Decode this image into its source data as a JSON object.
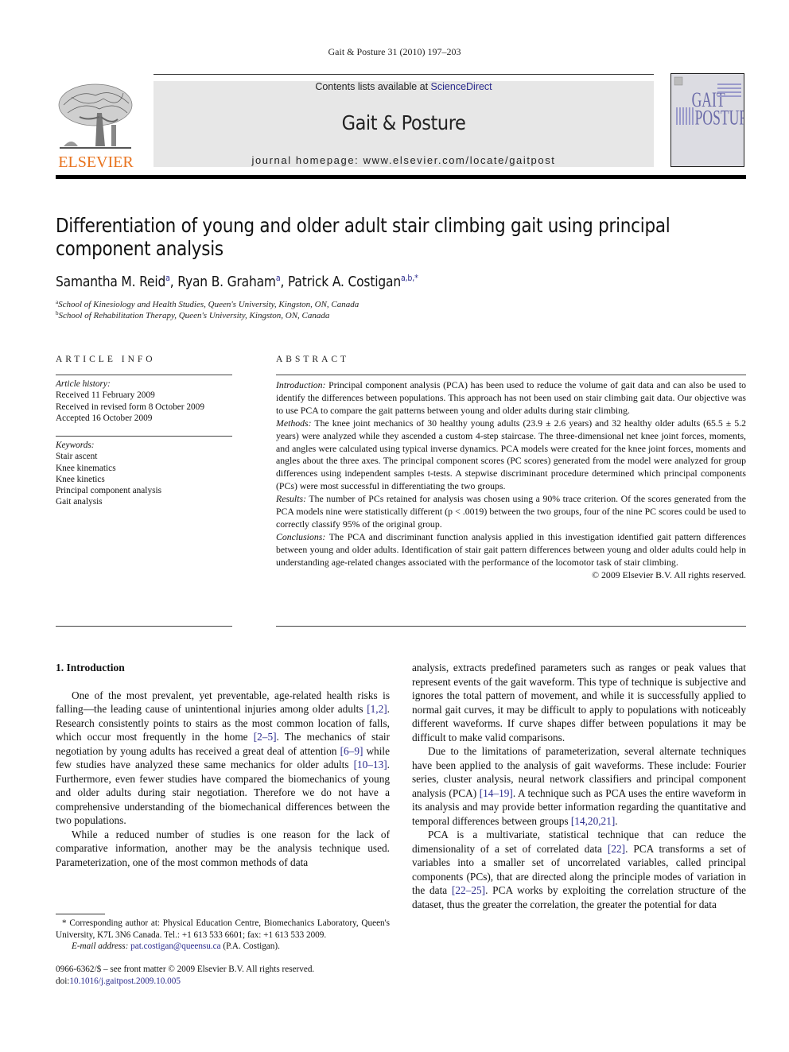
{
  "header": {
    "running_head": "Gait & Posture 31 (2010) 197–203",
    "contents_prefix": "Contents lists available at ",
    "contents_link": "ScienceDirect",
    "journal_name": "Gait & Posture",
    "homepage": "journal homepage: www.elsevier.com/locate/gaitpost",
    "publisher_logo": "ELSEVIER",
    "cover_title_top": "GAIT",
    "cover_title_bottom": "POSTURE",
    "colors": {
      "elsevier_orange": "#e8731e",
      "link_blue": "#2a2a8c",
      "banner_gray": "#e7e7e7"
    }
  },
  "article": {
    "title_line1": "Differentiation of young and older adult stair climbing gait using principal",
    "title_line2": "component analysis",
    "authors": [
      {
        "name": "Samantha M. Reid",
        "sup": "a",
        "sep": ", "
      },
      {
        "name": "Ryan B. Graham",
        "sup": "a",
        "sep": ", "
      },
      {
        "name": "Patrick A. Costigan",
        "sup": "a,b,*",
        "sep": ""
      }
    ],
    "affiliations": [
      {
        "mark": "a",
        "text": "School of Kinesiology and Health Studies, Queen's University, Kingston, ON, Canada"
      },
      {
        "mark": "b",
        "text": "School of Rehabilitation Therapy, Queen's University, Kingston, ON, Canada"
      }
    ]
  },
  "article_info": {
    "heading": "ARTICLE INFO",
    "history_label": "Article history:",
    "history": [
      "Received 11 February 2009",
      "Received in revised form 8 October 2009",
      "Accepted 16 October 2009"
    ],
    "keywords_label": "Keywords:",
    "keywords": [
      "Stair ascent",
      "Knee kinematics",
      "Knee kinetics",
      "Principal component analysis",
      "Gait analysis"
    ]
  },
  "abstract": {
    "heading": "ABSTRACT",
    "sections": [
      {
        "label": "Introduction:",
        "text": " Principal component analysis (PCA) has been used to reduce the volume of gait data and can also be used to identify the differences between populations. This approach has not been used on stair climbing gait data. Our objective was to use PCA to compare the gait patterns between young and older adults during stair climbing."
      },
      {
        "label": "Methods:",
        "text": " The knee joint mechanics of 30 healthy young adults (23.9 ± 2.6 years) and 32 healthy older adults (65.5 ± 5.2 years) were analyzed while they ascended a custom 4-step staircase. The three-dimensional net knee joint forces, moments, and angles were calculated using typical inverse dynamics. PCA models were created for the knee joint forces, moments and angles about the three axes. The principal component scores (PC scores) generated from the model were analyzed for group differences using independent samples t-tests. A stepwise discriminant procedure determined which principal components (PCs) were most successful in differentiating the two groups."
      },
      {
        "label": "Results:",
        "text": " The number of PCs retained for analysis was chosen using a 90% trace criterion. Of the scores generated from the PCA models nine were statistically different (p < .0019) between the two groups, four of the nine PC scores could be used to correctly classify 95% of the original group."
      },
      {
        "label": "Conclusions:",
        "text": " The PCA and discriminant function analysis applied in this investigation identified gait pattern differences between young and older adults. Identification of stair gait pattern differences between young and older adults could help in understanding age-related changes associated with the performance of the locomotor task of stair climbing."
      }
    ],
    "copyright": "© 2009 Elsevier B.V. All rights reserved."
  },
  "body": {
    "section_heading": "1. Introduction",
    "left_paragraphs": [
      [
        {
          "t": "One of the most prevalent, yet preventable, age-related health risks is falling—the leading cause of unintentional injuries among older adults "
        },
        {
          "ref": "[1,2]"
        },
        {
          "t": ". Research consistently points to stairs as the most common location of falls, which occur most frequently in the home "
        },
        {
          "ref": "[2–5]"
        },
        {
          "t": ". The mechanics of stair negotiation by young adults has received a great deal of attention "
        },
        {
          "ref": "[6–9]"
        },
        {
          "t": " while few studies have analyzed these same mechanics for older adults "
        },
        {
          "ref": "[10–13]"
        },
        {
          "t": ". Furthermore, even fewer studies have compared the biomechanics of young and older adults during stair negotiation. Therefore we do not have a comprehensive understanding of the biomechanical differences between the two populations."
        }
      ],
      [
        {
          "t": "While a reduced number of studies is one reason for the lack of comparative information, another may be the analysis technique used. Parameterization, one of the most common methods of data"
        }
      ]
    ],
    "right_paragraphs": [
      [
        {
          "t": "analysis, extracts predefined parameters such as ranges or peak values that represent events of the gait waveform. This type of technique is subjective and ignores the total pattern of movement, and while it is successfully applied to normal gait curves, it may be difficult to apply to populations with noticeably different waveforms. If curve shapes differ between populations it may be difficult to make valid comparisons."
        }
      ],
      [
        {
          "t": "Due to the limitations of parameterization, several alternate techniques have been applied to the analysis of gait waveforms. These include: Fourier series, cluster analysis, neural network classifiers and principal component analysis (PCA) "
        },
        {
          "ref": "[14–19]"
        },
        {
          "t": ". A technique such as PCA uses the entire waveform in its analysis and may provide better information regarding the quantitative and temporal differences between groups "
        },
        {
          "ref": "[14,20,21]"
        },
        {
          "t": "."
        }
      ],
      [
        {
          "t": "PCA is a multivariate, statistical technique that can reduce the dimensionality of a set of correlated data "
        },
        {
          "ref": "[22]"
        },
        {
          "t": ". PCA transforms a set of variables into a smaller set of uncorrelated variables, called principal components (PCs), that are directed along the principle modes of variation in the data "
        },
        {
          "ref": "[22–25]"
        },
        {
          "t": ". PCA works by exploiting the correlation structure of the dataset, thus the greater the correlation, the greater the potential for data"
        }
      ]
    ]
  },
  "footnote": {
    "corresponding": "* Corresponding author at: Physical Education Centre, Biomechanics Laboratory, Queen's University, K7L 3N6 Canada. Tel.: +1 613 533 6601; fax: +1 613 533 2009.",
    "email_label": "E-mail address:",
    "email": "pat.costigan@queensu.ca",
    "email_suffix": " (P.A. Costigan).",
    "issn_line": "0966-6362/$ – see front matter © 2009 Elsevier B.V. All rights reserved.",
    "doi_prefix": "doi:",
    "doi": "10.1016/j.gaitpost.2009.10.005"
  }
}
